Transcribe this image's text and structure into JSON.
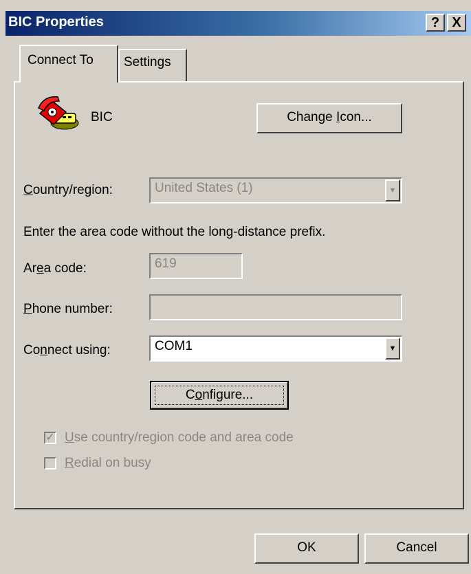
{
  "window": {
    "title": "BIC Properties",
    "help_glyph": "?",
    "close_glyph": "X"
  },
  "tabs": [
    {
      "label": "Connect To",
      "selected": true
    },
    {
      "label": "Settings",
      "selected": false
    }
  ],
  "connection": {
    "name": "BIC",
    "icon": "telephone-modem-icon"
  },
  "change_icon_button": {
    "pre": "Change ",
    "mn": "I",
    "post": "con..."
  },
  "country": {
    "label_mn": "C",
    "label_rest": "ountry/region:",
    "value": "United States (1)",
    "enabled": false
  },
  "instruction": "Enter the area code without the long-distance prefix.",
  "area_code": {
    "label_pre": "Ar",
    "label_mn": "e",
    "label_post": "a code:",
    "value": "619",
    "enabled": false
  },
  "phone_number": {
    "label_mn": "P",
    "label_rest": "hone number:",
    "value": "",
    "enabled": false
  },
  "connect_using": {
    "label_pre": "Co",
    "label_mn": "n",
    "label_post": "nect using:",
    "value": "COM1"
  },
  "configure_button": {
    "pre": "C",
    "mn": "o",
    "post": "nfigure..."
  },
  "use_country_code": {
    "mn": "U",
    "rest": "se country/region code and area code",
    "checked": true,
    "enabled": false
  },
  "redial": {
    "mn": "R",
    "rest": "edial on busy",
    "checked": false,
    "enabled": false
  },
  "footer": {
    "ok": "OK",
    "cancel": "Cancel"
  },
  "colors": {
    "face": "#d4d0c8",
    "title_start": "#0a246a",
    "title_end": "#a6caf0"
  }
}
